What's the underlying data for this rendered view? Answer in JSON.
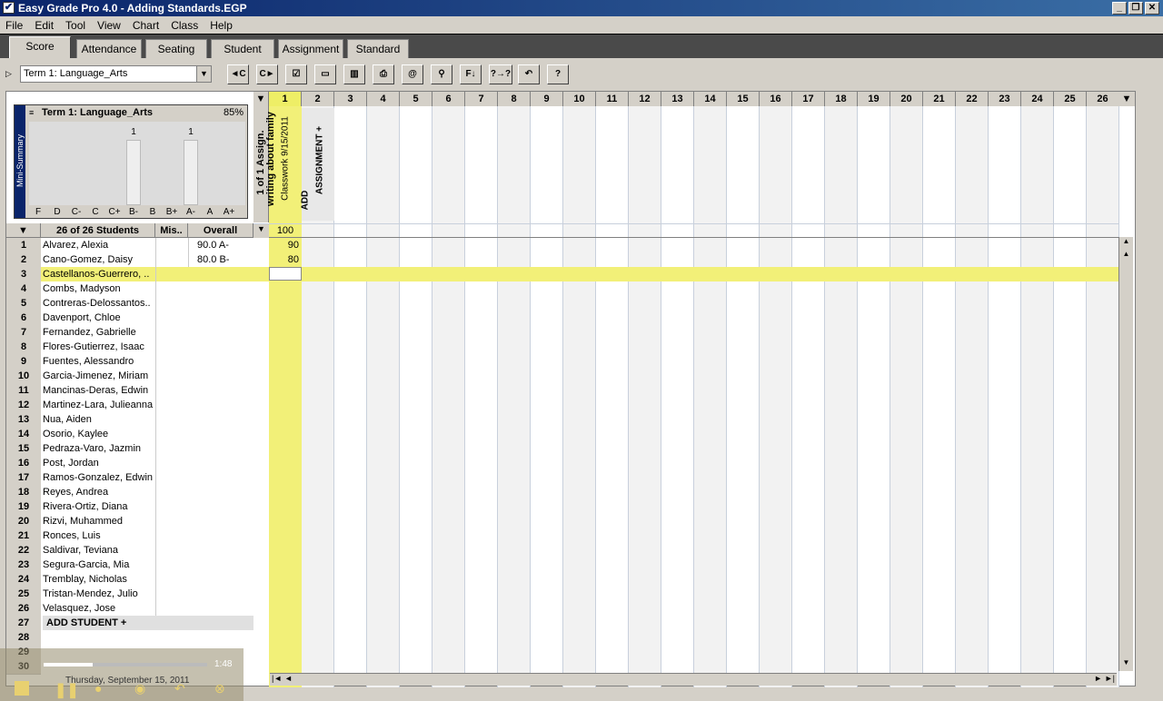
{
  "window": {
    "title": "Easy Grade Pro 4.0 - Adding Standards.EGP"
  },
  "menu": [
    "File",
    "Edit",
    "Tool",
    "View",
    "Chart",
    "Class",
    "Help"
  ],
  "tabs": [
    "Score",
    "Attendance",
    "Seating",
    "Student",
    "Assignment",
    "Standard"
  ],
  "term": {
    "selected": "Term 1: Language_Arts"
  },
  "toolbar_icons": [
    "prev-class-icon",
    "next-class-icon",
    "checkbox-icon",
    "folder-icon",
    "chart-icon",
    "print-icon",
    "email-icon",
    "search-icon",
    "fill-down-icon",
    "query-icon",
    "undo-icon",
    "help-icon"
  ],
  "toolbar_labels": [
    "◄C",
    "C►",
    "☑",
    "▭",
    "▥",
    "⎙",
    "@",
    "⚲",
    "F↓",
    "?→?",
    "↶",
    "?"
  ],
  "mini_summary": {
    "side_label": "Mini-Summary",
    "title": "Term 1: Language_Arts",
    "percent": "85%",
    "grades": [
      "F",
      "D",
      "C-",
      "C",
      "C+",
      "B-",
      "B",
      "B+",
      "A-",
      "A",
      "A+"
    ],
    "counts": [
      0,
      0,
      0,
      0,
      0,
      1,
      0,
      0,
      1,
      0,
      0
    ],
    "bar_label": "1"
  },
  "left_header": {
    "students": "26 of 26 Students",
    "missing": "Mis..",
    "overall": "Overall"
  },
  "assignment_header": {
    "summary": "1 of 1 Assign.",
    "assignment_name": "writing about family",
    "assignment_meta": "Classwork 9/15/2011",
    "add_label": "ADD",
    "add_label2": "ASSIGNMENT +",
    "points": "100"
  },
  "column_numbers": [
    "1",
    "2",
    "3",
    "4",
    "5",
    "6",
    "7",
    "8",
    "9",
    "10",
    "11",
    "12",
    "13",
    "14",
    "15",
    "16",
    "17",
    "18",
    "19",
    "20",
    "21",
    "22",
    "23",
    "24",
    "25",
    "26"
  ],
  "students": [
    {
      "num": "1",
      "name": "Alvarez, Alexia",
      "overall": "90.0 A-",
      "score": "90"
    },
    {
      "num": "2",
      "name": "Cano-Gomez, Daisy",
      "overall": "80.0 B-",
      "score": "80"
    },
    {
      "num": "3",
      "name": "Castellanos-Guerrero, ..",
      "overall": "",
      "score": ""
    },
    {
      "num": "4",
      "name": "Combs, Madyson",
      "overall": "",
      "score": ""
    },
    {
      "num": "5",
      "name": "Contreras-Delossantos..",
      "overall": "",
      "score": ""
    },
    {
      "num": "6",
      "name": "Davenport, Chloe",
      "overall": "",
      "score": ""
    },
    {
      "num": "7",
      "name": "Fernandez, Gabrielle",
      "overall": "",
      "score": ""
    },
    {
      "num": "8",
      "name": "Flores-Gutierrez, Isaac",
      "overall": "",
      "score": ""
    },
    {
      "num": "9",
      "name": "Fuentes, Alessandro",
      "overall": "",
      "score": ""
    },
    {
      "num": "10",
      "name": "Garcia-Jimenez, Miriam",
      "overall": "",
      "score": ""
    },
    {
      "num": "11",
      "name": "Mancinas-Deras, Edwin",
      "overall": "",
      "score": ""
    },
    {
      "num": "12",
      "name": "Martinez-Lara, Julieanna",
      "overall": "",
      "score": ""
    },
    {
      "num": "13",
      "name": "Nua, Aiden",
      "overall": "",
      "score": ""
    },
    {
      "num": "14",
      "name": "Osorio, Kaylee",
      "overall": "",
      "score": ""
    },
    {
      "num": "15",
      "name": "Pedraza-Varo, Jazmin",
      "overall": "",
      "score": ""
    },
    {
      "num": "16",
      "name": "Post, Jordan",
      "overall": "",
      "score": ""
    },
    {
      "num": "17",
      "name": "Ramos-Gonzalez, Edwin",
      "overall": "",
      "score": ""
    },
    {
      "num": "18",
      "name": "Reyes, Andrea",
      "overall": "",
      "score": ""
    },
    {
      "num": "19",
      "name": "Rivera-Ortiz, Diana",
      "overall": "",
      "score": ""
    },
    {
      "num": "20",
      "name": "Rizvi, Muhammed",
      "overall": "",
      "score": ""
    },
    {
      "num": "21",
      "name": "Ronces, Luis",
      "overall": "",
      "score": ""
    },
    {
      "num": "22",
      "name": "Saldivar, Teviana",
      "overall": "",
      "score": ""
    },
    {
      "num": "23",
      "name": "Segura-Garcia, Mia",
      "overall": "",
      "score": ""
    },
    {
      "num": "24",
      "name": "Tremblay, Nicholas",
      "overall": "",
      "score": ""
    },
    {
      "num": "25",
      "name": "Tristan-Mendez, Julio",
      "overall": "",
      "score": ""
    },
    {
      "num": "26",
      "name": "Velasquez, Jose",
      "overall": "",
      "score": ""
    }
  ],
  "extra_rows": [
    "27",
    "28",
    "29",
    "30"
  ],
  "add_student": "ADD STUDENT +",
  "selected_row": "3",
  "player": {
    "time": "1:48",
    "date": "Thursday, September 15, 2011"
  },
  "colors": {
    "highlight": "#f2f078",
    "title_bar": "#0a246a",
    "selected_column": "#eeee66"
  }
}
